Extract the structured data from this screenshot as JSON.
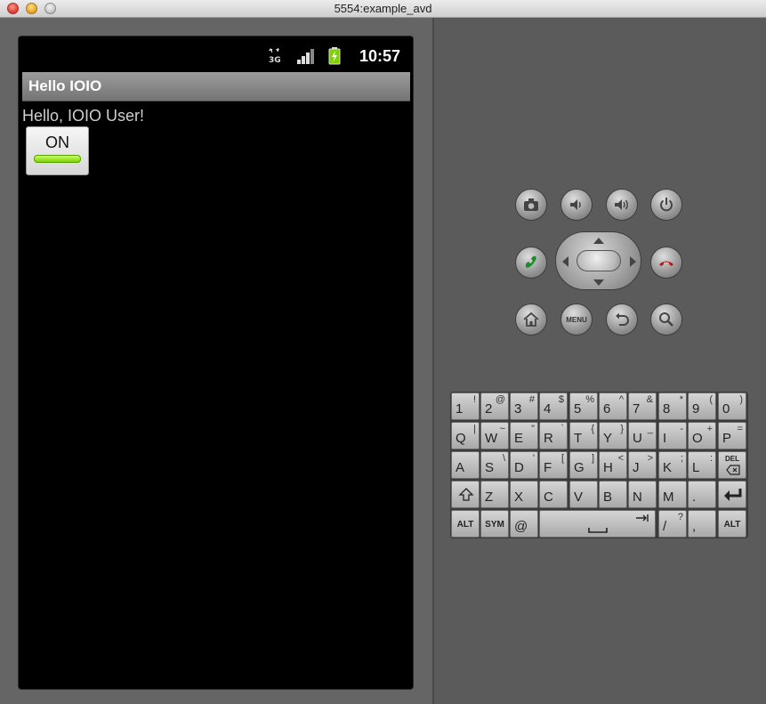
{
  "window": {
    "title": "5554:example_avd"
  },
  "device": {
    "status_bar": {
      "network": "3G",
      "time": "10:57"
    },
    "app": {
      "title": "Hello IOIO",
      "message": "Hello, IOIO User!",
      "toggle": {
        "label": "ON",
        "state": "on"
      }
    }
  },
  "hardware_buttons": {
    "row1": [
      "camera-icon",
      "volume-down-icon",
      "volume-up-icon",
      "power-icon"
    ],
    "row2": [
      "call-icon",
      "dpad",
      "end-call-icon"
    ],
    "row3": [
      "home-icon",
      "menu",
      "back-icon",
      "search-icon"
    ],
    "menu_label": "MENU"
  },
  "keyboard": {
    "row1": [
      {
        "main": "1",
        "alt": "!"
      },
      {
        "main": "2",
        "alt": "@"
      },
      {
        "main": "3",
        "alt": "#"
      },
      {
        "main": "4",
        "alt": "$"
      },
      {
        "main": "5",
        "alt": "%"
      },
      {
        "main": "6",
        "alt": "^"
      },
      {
        "main": "7",
        "alt": "&"
      },
      {
        "main": "8",
        "alt": "*"
      },
      {
        "main": "9",
        "alt": "("
      },
      {
        "main": "0",
        "alt": ")"
      }
    ],
    "row2": [
      {
        "main": "Q",
        "alt": "|"
      },
      {
        "main": "W",
        "alt": "~"
      },
      {
        "main": "E",
        "alt": "\""
      },
      {
        "main": "R",
        "alt": "`"
      },
      {
        "main": "T",
        "alt": "{"
      },
      {
        "main": "Y",
        "alt": "}"
      },
      {
        "main": "U",
        "alt": "_"
      },
      {
        "main": "I",
        "alt": "-"
      },
      {
        "main": "O",
        "alt": "+"
      },
      {
        "main": "P",
        "alt": "="
      }
    ],
    "row3": [
      {
        "main": "A",
        "alt": ""
      },
      {
        "main": "S",
        "alt": "\\"
      },
      {
        "main": "D",
        "alt": "'"
      },
      {
        "main": "F",
        "alt": "["
      },
      {
        "main": "G",
        "alt": "]"
      },
      {
        "main": "H",
        "alt": "<"
      },
      {
        "main": "J",
        "alt": ">"
      },
      {
        "main": "K",
        "alt": ";"
      },
      {
        "main": "L",
        "alt": ":"
      },
      {
        "main": "DEL",
        "alt": ""
      }
    ],
    "row4": [
      {
        "main": "shift",
        "alt": ""
      },
      {
        "main": "Z",
        "alt": ""
      },
      {
        "main": "X",
        "alt": ""
      },
      {
        "main": "C",
        "alt": ""
      },
      {
        "main": "V",
        "alt": ""
      },
      {
        "main": "B",
        "alt": ""
      },
      {
        "main": "N",
        "alt": ""
      },
      {
        "main": "M",
        "alt": ""
      },
      {
        "main": ".",
        "alt": ""
      },
      {
        "main": "enter",
        "alt": ""
      }
    ],
    "row5": [
      {
        "main": "ALT",
        "alt": ""
      },
      {
        "main": "SYM",
        "alt": ""
      },
      {
        "main": "@",
        "alt": ""
      },
      {
        "main": "space",
        "alt": ""
      },
      {
        "main": "/",
        "alt": "?"
      },
      {
        "main": ",",
        "alt": ""
      },
      {
        "main": "ALT",
        "alt": ""
      }
    ]
  },
  "colors": {
    "toggle_on": "#7fd100",
    "screen_bg": "#000000",
    "appbar": "#8a8a8a"
  }
}
